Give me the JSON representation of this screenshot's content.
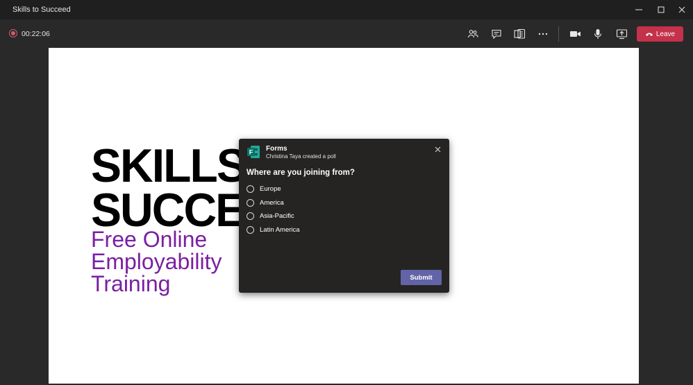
{
  "window": {
    "title": "Skills to Succeed"
  },
  "toolbar": {
    "timer": "00:22:06",
    "leave_label": "Leave"
  },
  "slide": {
    "line1": "SKILLS",
    "line2": "SUCCE",
    "line3": "Free Online",
    "line4": "Employability",
    "line5": "Training",
    "accent_color": "#7b1fa2"
  },
  "poll": {
    "app_name": "Forms",
    "creator_text": "Christina Taya created a poll",
    "question": "Where are you joining from?",
    "options": [
      "Europe",
      "America",
      "Asia-Pacific",
      "Latin America"
    ],
    "submit_label": "Submit"
  },
  "colors": {
    "leave_red": "#c4314b",
    "submit_purple": "#6264a7",
    "forms_green": "#077568"
  }
}
